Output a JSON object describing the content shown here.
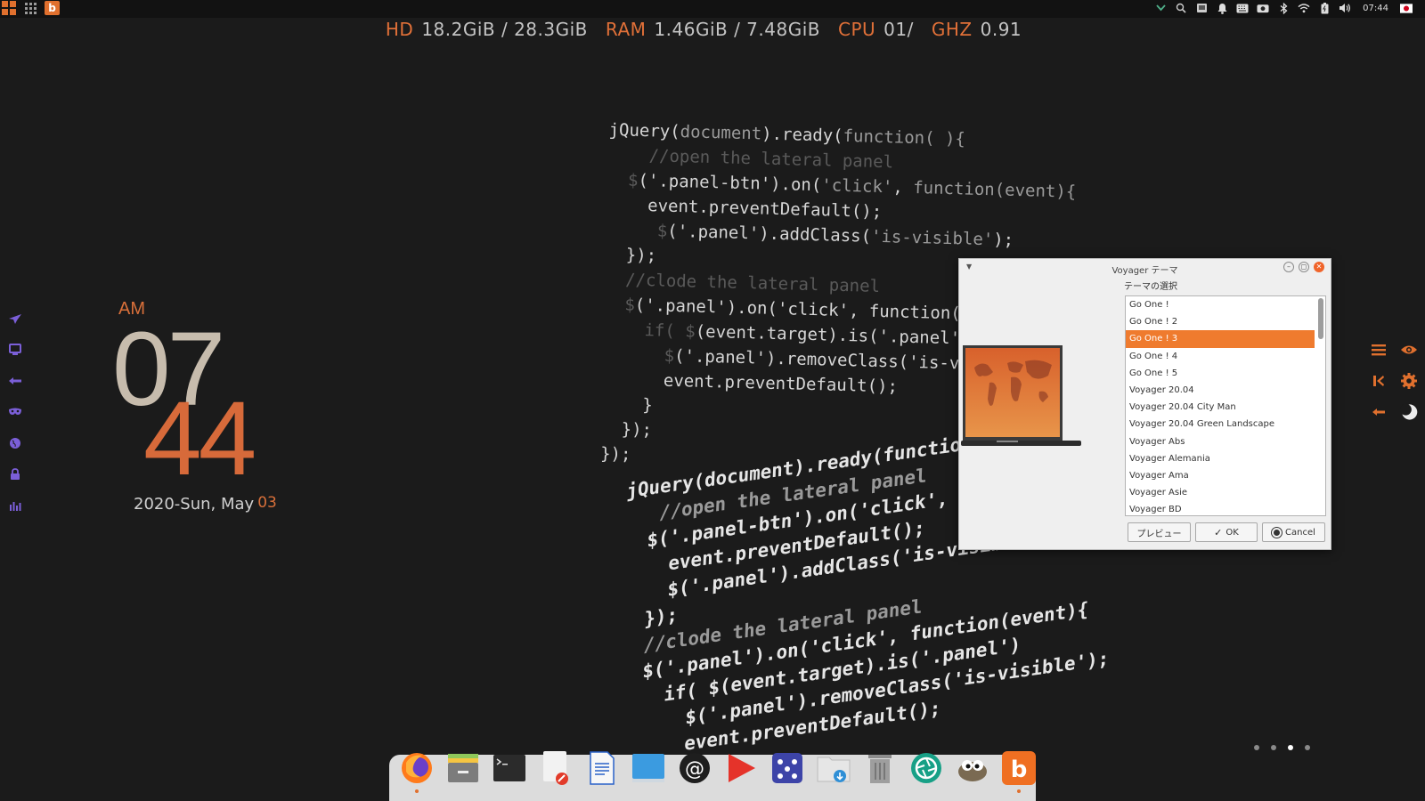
{
  "top_panel": {
    "menu_logo": "menu-logo-icon",
    "apps_grid": "apps-grid-icon",
    "brand": "b",
    "tray_icons": [
      "chevron-down-icon",
      "search-icon",
      "clipboard-icon",
      "notification-bell-icon",
      "keyboard-icon",
      "screenshot-icon",
      "bluetooth-icon",
      "wifi-icon",
      "battery-icon",
      "volume-icon"
    ],
    "clock": "07:44",
    "locale_flag": "japan-flag-icon"
  },
  "stats": {
    "hd_label": "HD",
    "hd_value": "18.2GiB / 28.3GiB",
    "ram_label": "RAM",
    "ram_value": "1.46GiB / 7.48GiB",
    "cpu_label": "CPU",
    "cpu_value": "01/",
    "ghz_label": "GHZ",
    "ghz_value": "0.91"
  },
  "clock_widget": {
    "ampm": "AM",
    "hours": "07",
    "minutes": "44",
    "date_prefix": "2020-Sun, May",
    "date_day": "03"
  },
  "left_dock": {
    "icons": [
      "airplane-icon",
      "monitor-icon",
      "arrow-left-icon",
      "mask-icon",
      "globe-icon",
      "lock-icon",
      "stats-icon"
    ]
  },
  "right_dock": {
    "icons": [
      "menu-lines-icon",
      "eye-icon",
      "skip-back-icon",
      "gear-icon",
      "arrow-left-icon",
      "moon-icon"
    ]
  },
  "page_dots": {
    "count": 4,
    "active_index": 2
  },
  "dialog": {
    "title": "Voyager テーマ",
    "subtitle": "テーマの選択",
    "themes": [
      "Go One !",
      "Go One ! 2",
      "Go One ! 3",
      "Go One ! 4",
      "Go One ! 5",
      "Voyager 20.04",
      "Voyager 20.04 City Man",
      "Voyager 20.04 Green Landscape",
      "Voyager Abs",
      "Voyager Alemania",
      "Voyager Ama",
      "Voyager Asie",
      "Voyager BD"
    ],
    "selected_index": 2,
    "buttons": {
      "preview": "プレビュー",
      "ok": "OK",
      "cancel": "Cancel"
    }
  },
  "bottom_dock": {
    "apps": [
      "firefox-icon",
      "file-manager-icon",
      "terminal-icon",
      "text-editor-icon",
      "writer-document-icon",
      "desktop-icon",
      "mail-client-icon",
      "media-player-icon",
      "dice-game-icon",
      "downloads-folder-icon",
      "trash-icon",
      "camera-shutter-icon",
      "gimp-icon",
      "brand-b-icon"
    ],
    "running": [
      "firefox-icon",
      "brand-b-icon"
    ]
  },
  "colors": {
    "accent": "#e0702e",
    "desktop_bg": "#1b1b1b",
    "panel_bg": "#121212",
    "dialog_bg": "#efefef",
    "selection": "#ef7b2e"
  }
}
